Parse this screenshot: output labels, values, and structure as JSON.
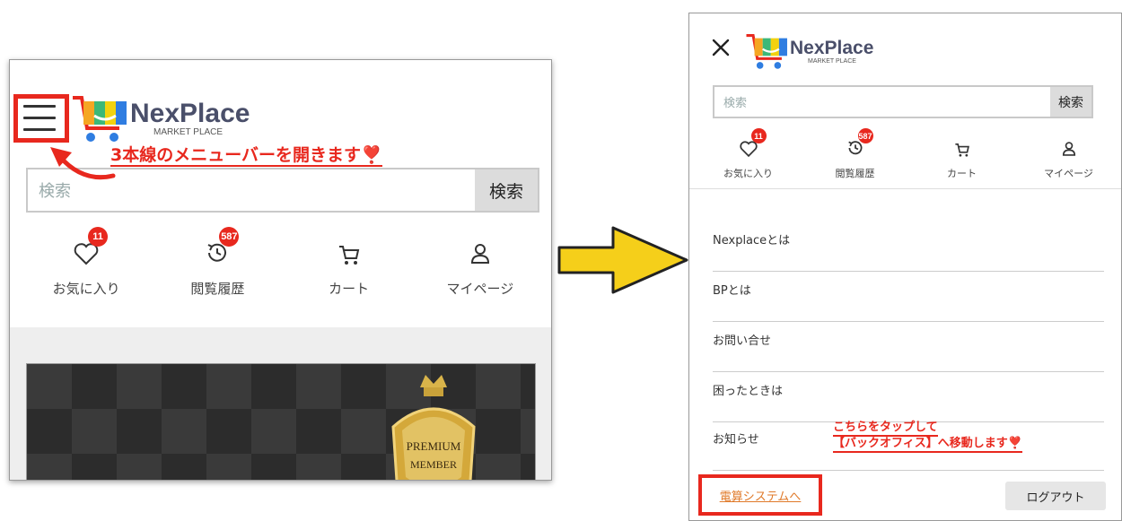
{
  "brand": {
    "name": "NexPlace",
    "sub": "MARKET PLACE"
  },
  "left": {
    "annotation": "3本線のメニューバーを開きます❣️",
    "search": {
      "placeholder": "検索",
      "button": "検索"
    },
    "nav": [
      {
        "label": "お気に入り",
        "icon": "heart-icon",
        "badge": "11"
      },
      {
        "label": "閲覧履歴",
        "icon": "history-icon",
        "badge": "587"
      },
      {
        "label": "カート",
        "icon": "cart-icon",
        "badge": ""
      },
      {
        "label": "マイページ",
        "icon": "user-icon",
        "badge": ""
      }
    ],
    "banner": {
      "line1": "PREMIUM",
      "line2": "MEMBER"
    }
  },
  "right": {
    "search": {
      "placeholder": "検索",
      "button": "検索"
    },
    "nav": [
      {
        "label": "お気に入り",
        "icon": "heart-icon",
        "badge": "11"
      },
      {
        "label": "閲覧履歴",
        "icon": "history-icon",
        "badge": "587"
      },
      {
        "label": "カート",
        "icon": "cart-icon",
        "badge": ""
      },
      {
        "label": "マイページ",
        "icon": "user-icon",
        "badge": ""
      }
    ],
    "menu": [
      {
        "label": "Nexplaceとは"
      },
      {
        "label": "BPとは"
      },
      {
        "label": "お問い合せ"
      },
      {
        "label": "困ったときは"
      },
      {
        "label": "お知らせ"
      }
    ],
    "annotation_line1": "こちらをタップして",
    "annotation_line2": "【バックオフィス】へ移動します❣️",
    "denko_link": "電算システムへ",
    "logout": "ログアウト"
  },
  "colors": {
    "annotation_red": "#e8281e",
    "arrow_yellow": "#f5cf1a",
    "link_orange": "#e07a2a"
  }
}
